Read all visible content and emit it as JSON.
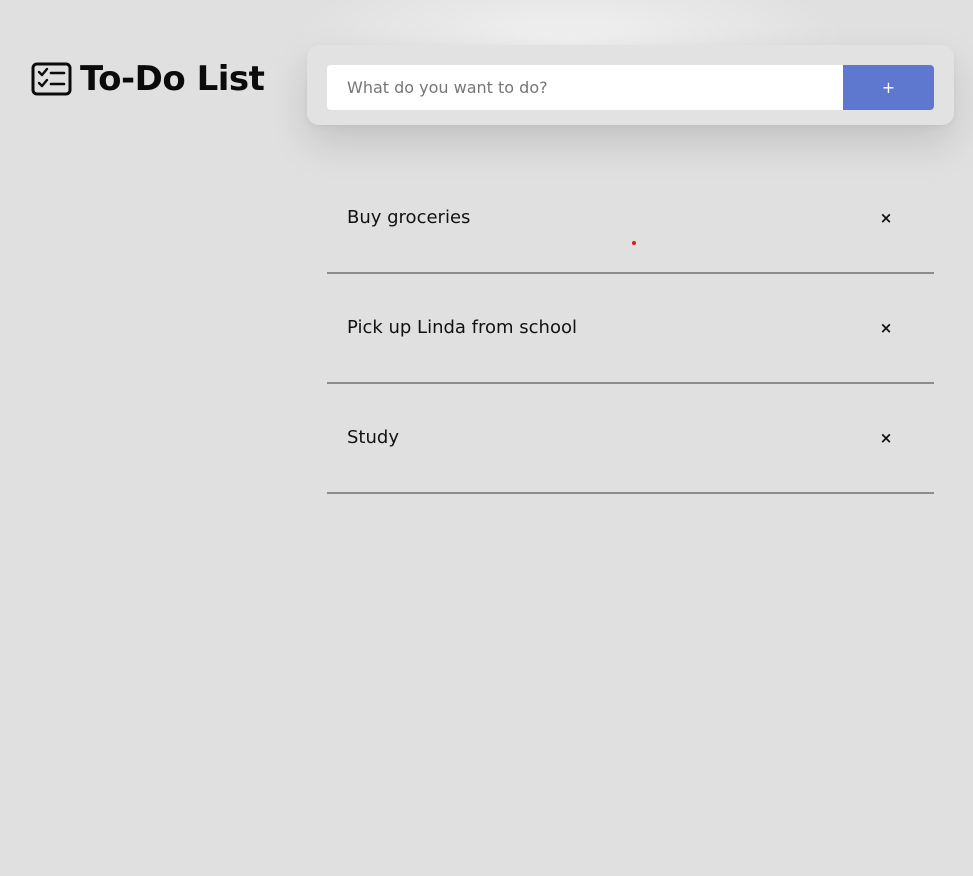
{
  "app": {
    "title": "To-Do List",
    "icon": "checklist-icon"
  },
  "form": {
    "placeholder": "What do you want to do?",
    "value": "",
    "add_label": "+"
  },
  "todos": [
    {
      "text": "Buy groceries",
      "delete_label": "×"
    },
    {
      "text": "Pick up Linda from school",
      "delete_label": "×"
    },
    {
      "text": "Study",
      "delete_label": "×"
    }
  ],
  "colors": {
    "background": "#e0e0e0",
    "accent": "#5f78cf",
    "divider": "#8c8c8c",
    "cursor": "#d21f1f"
  }
}
